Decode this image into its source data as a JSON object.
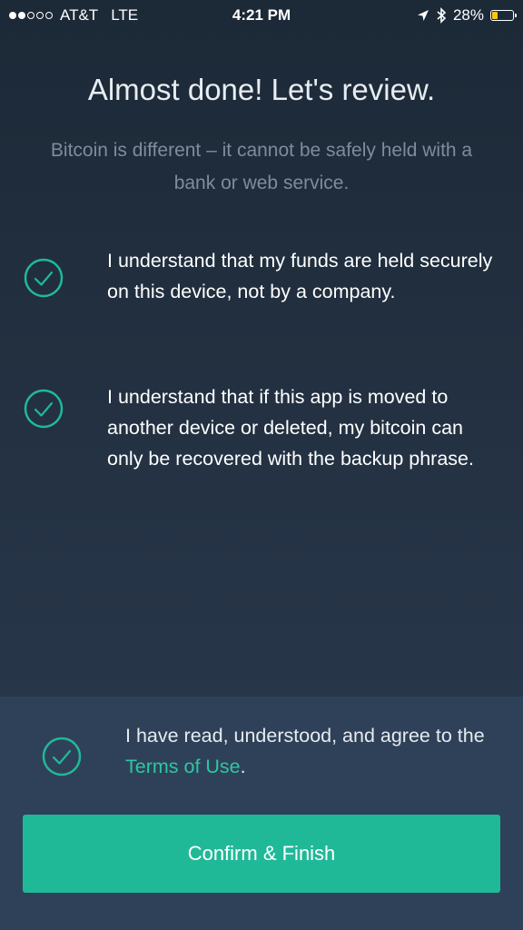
{
  "status_bar": {
    "carrier": "AT&T",
    "network": "LTE",
    "time": "4:21 PM",
    "battery_percent": "28%",
    "battery_level": 0.28,
    "signal_bars_filled": 2,
    "signal_bars_total": 5,
    "icons": [
      "location-arrow-icon",
      "bluetooth-icon",
      "battery-icon"
    ]
  },
  "header": {
    "title": "Almost done! Let's review.",
    "subtitle": "Bitcoin is different – it cannot be safely held with a bank or web service."
  },
  "checklist": [
    {
      "text": "I understand that my funds are held securely on this device, not by a company.",
      "checked": true
    },
    {
      "text": "I understand that if this app is moved to another device or deleted, my bitcoin can only be recovered with the backup phrase.",
      "checked": true
    }
  ],
  "terms": {
    "prefix": "I have read, understood, and agree to the ",
    "link_label": "Terms of Use",
    "suffix": ".",
    "checked": true
  },
  "confirm_button": {
    "label": "Confirm & Finish"
  },
  "colors": {
    "accent": "#20b998",
    "link": "#2fc6a4",
    "background_top": "#1c2937",
    "background_bottom": "#2a3a4f",
    "panel": "#2f4158",
    "battery": "#f5c518"
  }
}
